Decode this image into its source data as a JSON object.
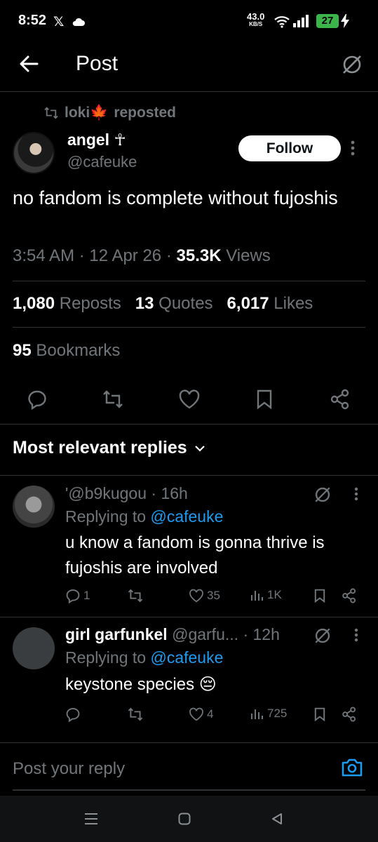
{
  "status": {
    "time": "8:52",
    "x_label": "𝕏",
    "speed_value": "43.0",
    "speed_unit": "KB/S",
    "battery": "27"
  },
  "header": {
    "title": "Post"
  },
  "post": {
    "repost_by": "loki🍁",
    "repost_suffix": "reposted",
    "author_name": "angel ☥",
    "author_handle": "@cafeuke",
    "follow_label": "Follow",
    "text": "no fandom is complete without fujoshis",
    "time": "3:54 AM",
    "date": "12 Apr 26",
    "views_count": "35.3K",
    "views_label": "Views",
    "reposts_count": "1,080",
    "reposts_label": "Reposts",
    "quotes_count": "13",
    "quotes_label": "Quotes",
    "likes_count": "6,017",
    "likes_label": "Likes",
    "bookmarks_count": "95",
    "bookmarks_label": "Bookmarks"
  },
  "replies_section": {
    "heading": "Most relevant replies"
  },
  "replies": [
    {
      "name": "",
      "handle": "'@b9kugou",
      "time": "16h",
      "replying_prefix": "Replying to",
      "replying_to": "@cafeuke",
      "text": "u know a fandom is gonna thrive is fujoshis are involved",
      "reply_count": "1",
      "repost_count": "",
      "like_count": "35",
      "view_count": "1K"
    },
    {
      "name": "girl garfunkel",
      "handle": "@garfu...",
      "time": "12h",
      "replying_prefix": "Replying to",
      "replying_to": "@cafeuke",
      "text": "keystone species 😔",
      "reply_count": "",
      "repost_count": "",
      "like_count": "4",
      "view_count": "725"
    }
  ],
  "compose": {
    "placeholder": "Post your reply"
  },
  "colors": {
    "background": "#000000",
    "text": "#e7e9ea",
    "muted": "#71767b",
    "accent": "#1d9bf0",
    "divider": "#2f3336",
    "battery": "#3bb44a"
  },
  "icons": [
    "x-logo-icon",
    "cloud-icon",
    "wifi-icon",
    "signal-icon",
    "bolt-icon",
    "back-arrow-icon",
    "grok-icon",
    "retweet-icon",
    "maple-leaf-icon",
    "more-icon",
    "reply-icon",
    "heart-icon",
    "bookmark-icon",
    "share-icon",
    "views-icon",
    "chevron-down-icon",
    "camera-icon",
    "menu-icon",
    "home-square-icon",
    "back-triangle-icon"
  ]
}
